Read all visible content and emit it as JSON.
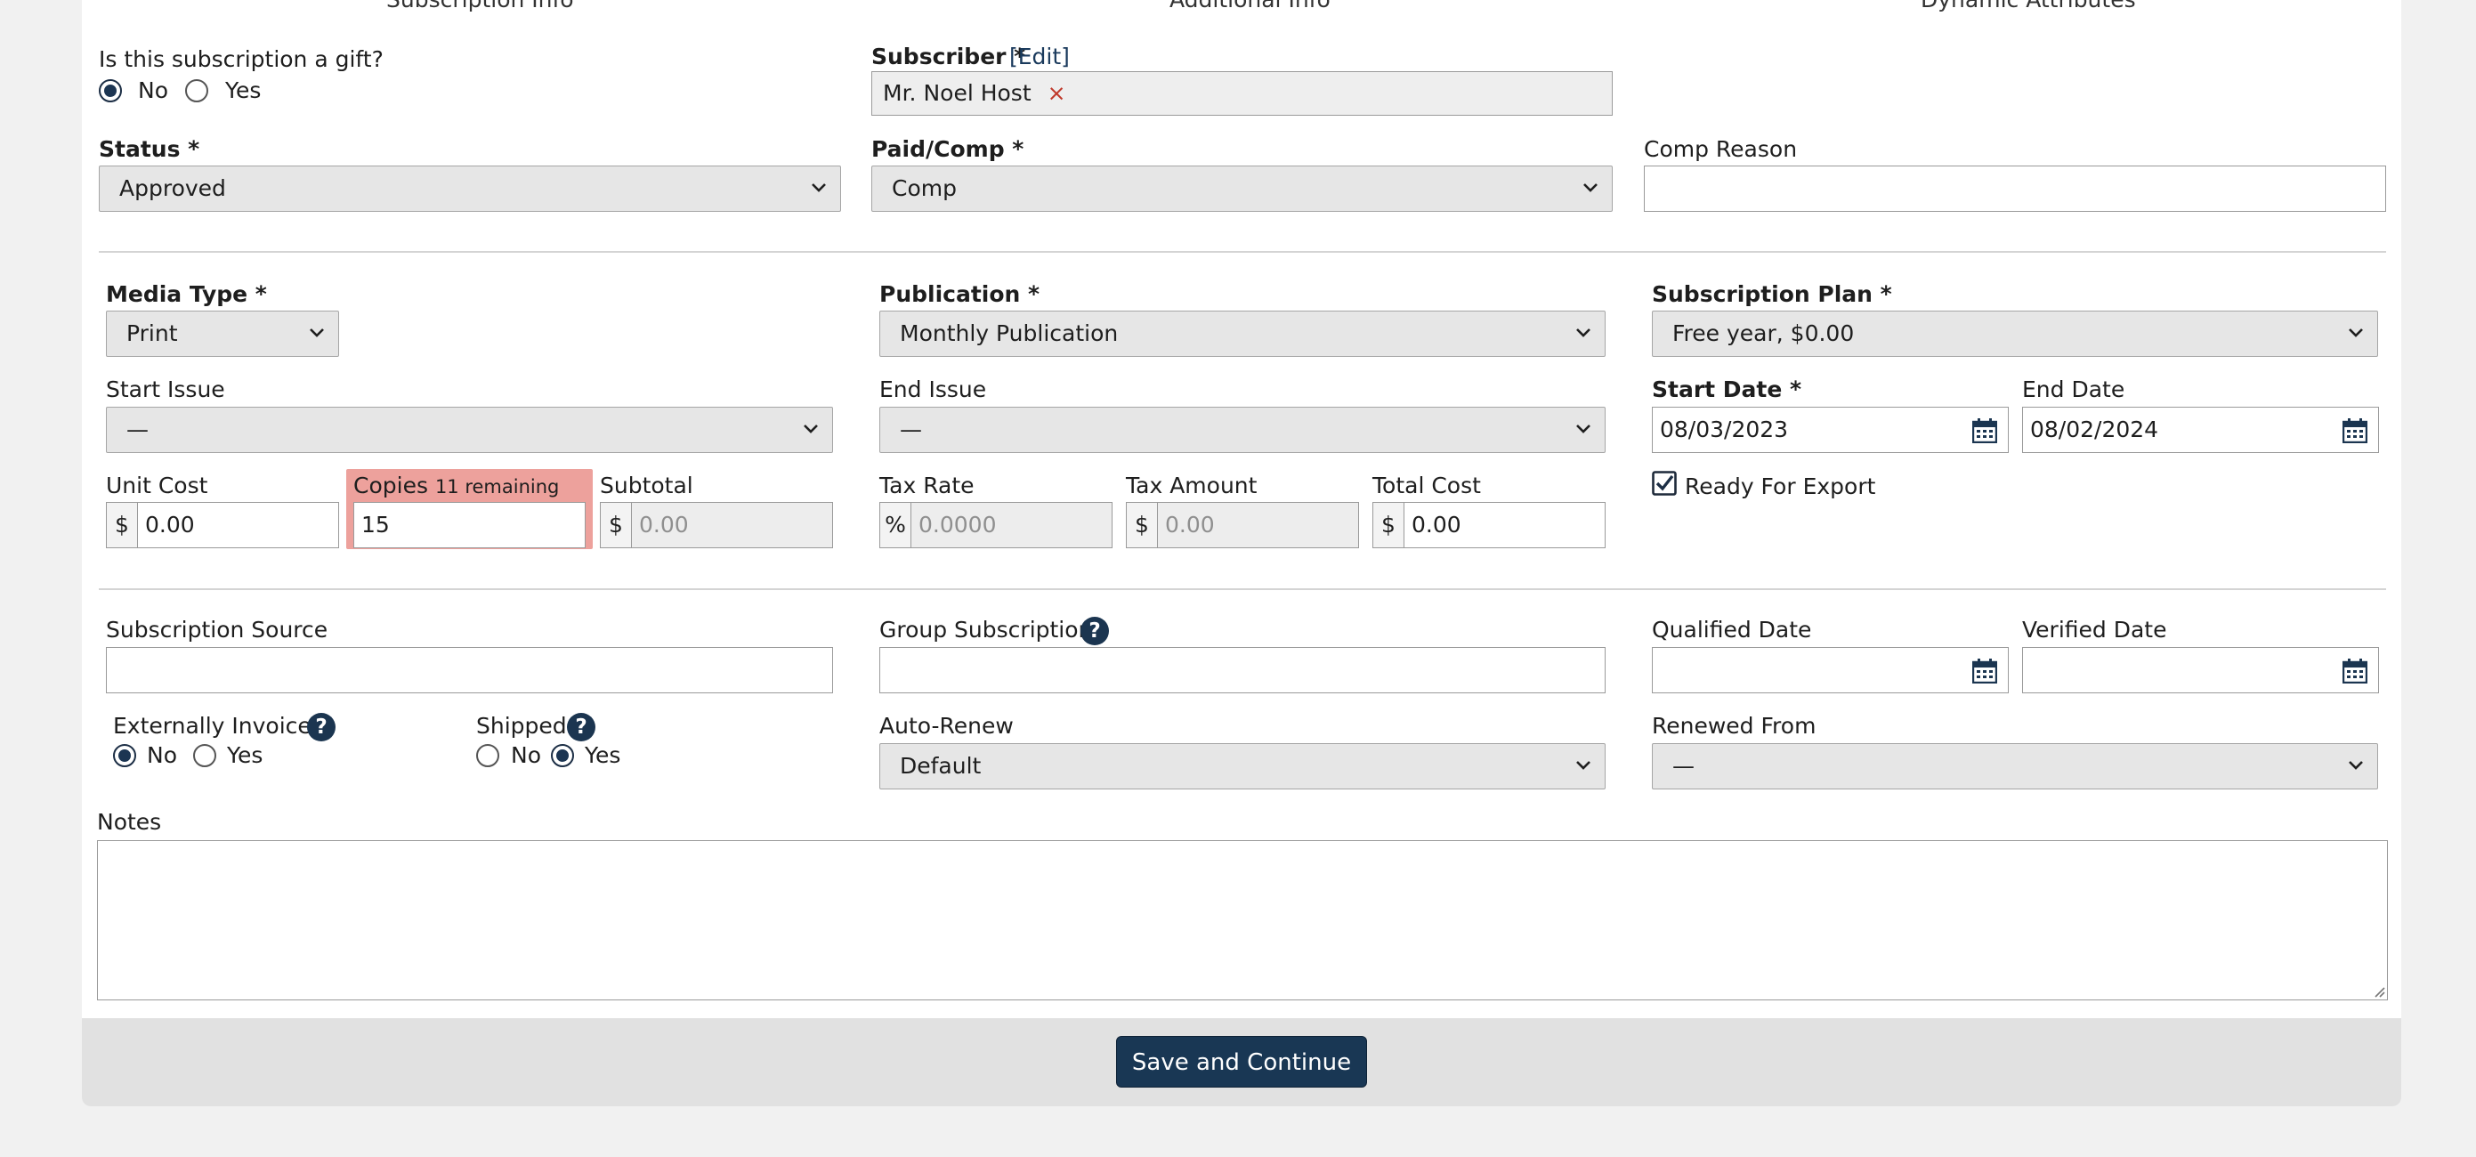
{
  "tabs": [
    "Subscription Info",
    "Additional Info",
    "Dynamic Attributes"
  ],
  "gift": {
    "question": "Is this subscription a gift?",
    "no": "No",
    "yes": "Yes",
    "selected": "No"
  },
  "subscriber": {
    "label": "Subscriber *",
    "edit_link": "[Edit]",
    "value": "Mr. Noel Host",
    "remove_glyph": "×"
  },
  "status": {
    "label": "Status *",
    "value": "Approved"
  },
  "paid_comp": {
    "label": "Paid/Comp *",
    "value": "Comp"
  },
  "comp_reason": {
    "label": "Comp Reason",
    "value": ""
  },
  "media_type": {
    "label": "Media Type *",
    "value": "Print"
  },
  "publication": {
    "label": "Publication *",
    "value": "Monthly Publication"
  },
  "subscription_plan": {
    "label": "Subscription Plan *",
    "value": "Free year, $0.00"
  },
  "start_issue": {
    "label": "Start Issue",
    "value": "—"
  },
  "end_issue": {
    "label": "End Issue",
    "value": "—"
  },
  "start_date": {
    "label": "Start Date *",
    "value": "08/03/2023"
  },
  "end_date": {
    "label": "End Date",
    "value": "08/02/2024"
  },
  "unit_cost": {
    "label": "Unit Cost",
    "prefix": "$",
    "value": "0.00"
  },
  "copies": {
    "label": "Copies",
    "remaining": "11 remaining",
    "value": "15"
  },
  "subtotal": {
    "label": "Subtotal",
    "prefix": "$",
    "value": "0.00"
  },
  "tax_rate": {
    "label": "Tax Rate",
    "prefix": "%",
    "value": "0.0000"
  },
  "tax_amount": {
    "label": "Tax Amount",
    "prefix": "$",
    "value": "0.00"
  },
  "total_cost": {
    "label": "Total Cost",
    "prefix": "$",
    "value": "0.00"
  },
  "ready_for_export": {
    "label": "Ready For Export",
    "checked": true
  },
  "subscription_source": {
    "label": "Subscription Source",
    "value": ""
  },
  "group_subscription": {
    "label": "Group Subscription",
    "value": ""
  },
  "qualified_date": {
    "label": "Qualified Date",
    "value": ""
  },
  "verified_date": {
    "label": "Verified Date",
    "value": ""
  },
  "externally_invoiced": {
    "label": "Externally Invoiced",
    "no": "No",
    "yes": "Yes",
    "selected": "No"
  },
  "shipped": {
    "label": "Shipped",
    "no": "No",
    "yes": "Yes",
    "selected": "Yes"
  },
  "auto_renew": {
    "label": "Auto-Renew",
    "value": "Default"
  },
  "renewed_from": {
    "label": "Renewed From",
    "value": "—"
  },
  "notes": {
    "label": "Notes",
    "value": ""
  },
  "save_button": "Save and Continue",
  "icons": {
    "help": "?",
    "calendar": "calendar-icon",
    "chevron": "chevron-down-icon"
  },
  "colors": {
    "primary": "#193754",
    "copies_warning": "#eda19c",
    "remove_x": "#c0392b"
  }
}
